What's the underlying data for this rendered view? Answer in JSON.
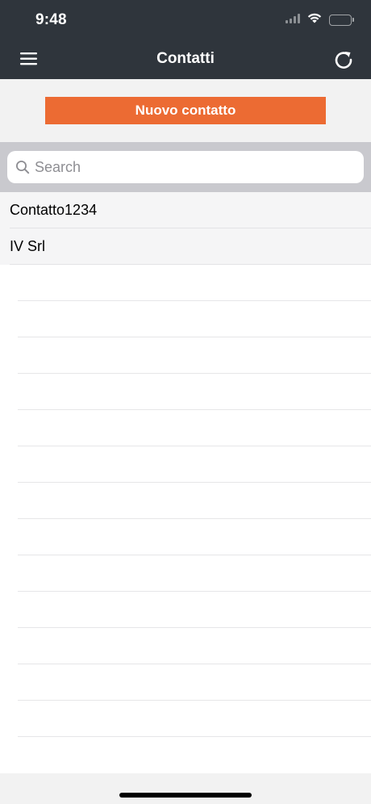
{
  "status_bar": {
    "time": "9:48",
    "icons": [
      "signal-icon",
      "wifi-icon",
      "battery-icon"
    ]
  },
  "nav": {
    "title": "Contatti",
    "left_icon": "hamburger-menu-icon",
    "right_icon": "refresh-icon"
  },
  "actions": {
    "new_contact_label": "Nuovo contatto"
  },
  "search": {
    "placeholder": "Search",
    "value": ""
  },
  "contacts": [
    {
      "name": "Contatto1234"
    },
    {
      "name": "IV Srl"
    }
  ],
  "colors": {
    "header_bg": "#2f353c",
    "accent": "#ec6b33",
    "search_bar_bg": "#c9c9ce"
  }
}
